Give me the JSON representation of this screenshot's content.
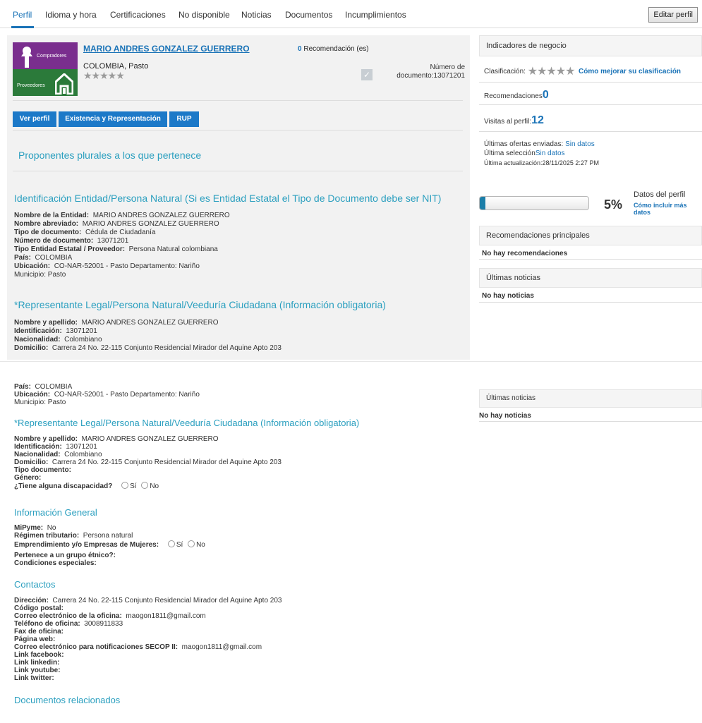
{
  "tabs": [
    "Perfil",
    "Idioma y hora",
    "Certificaciones",
    "No disponible",
    "Noticias",
    "Documentos",
    "Incumplimientos"
  ],
  "edit_button": "Editar perfil",
  "profile": {
    "logo_top_label": "Compradores",
    "logo_bottom_label": "Proveedores",
    "name": "MARIO ANDRES GONZALEZ GUERRERO",
    "location": "COLOMBIA, Pasto",
    "rec_count": "0",
    "rec_label": "Recomendación (es)",
    "doc_label": "Número de",
    "doc_value": "documento:13071201",
    "stars_filled": 0,
    "stars_total": 5
  },
  "buttons": [
    "Ver perfil",
    "Existencia y Representación",
    "RUP"
  ],
  "sections": {
    "plural": "Proponentes plurales a los que pertenece",
    "identification": "Identificación Entidad/Persona Natural (Si es Entidad Estatal el Tipo de Documento debe ser NIT)",
    "legal_rep": "*Representante Legal/Persona Natural/Veeduría Ciudadana (Información obligatoria)",
    "general": "Información General",
    "contacts": "Contactos",
    "documents": "Documentos relacionados"
  },
  "identification_fields": [
    {
      "label": "Nombre de la Entidad:",
      "value": "MARIO ANDRES GONZALEZ GUERRERO"
    },
    {
      "label": "Nombre abreviado:",
      "value": "MARIO ANDRES GONZALEZ GUERRERO"
    },
    {
      "label": "Tipo de documento:",
      "value": "Cédula de Ciudadanía"
    },
    {
      "label": "Número de documento:",
      "value": "13071201"
    },
    {
      "label": "Tipo Entidad Estatal / Proveedor:",
      "value": "Persona Natural colombiana"
    },
    {
      "label": "País:",
      "value": "COLOMBIA"
    },
    {
      "label": "Ubicación:",
      "value": "CO-NAR-52001 - Pasto Departamento: Nariño"
    },
    {
      "label": "",
      "value": "Municipio: Pasto"
    }
  ],
  "legal_rep_fields": [
    {
      "label": "Nombre y apellido:",
      "value": "MARIO ANDRES GONZALEZ GUERRERO"
    },
    {
      "label": "Identificación:",
      "value": "13071201"
    },
    {
      "label": "Nacionalidad:",
      "value": "Colombiano"
    },
    {
      "label": "Domicilio:",
      "value": "Carrera 24 No. 22-115 Conjunto Residencial Mirador del Aquine Apto 203"
    },
    {
      "label": "Tipo documento:",
      "value": ""
    },
    {
      "label": "Género:",
      "value": ""
    }
  ],
  "disability": {
    "label": "¿Tiene alguna discapacidad?",
    "yes": "Sí",
    "no": "No"
  },
  "general_fields": [
    {
      "label": "MiPyme:",
      "value": "No"
    },
    {
      "label": "Régimen tributario:",
      "value": "Persona natural"
    }
  ],
  "women_business": {
    "label": "Emprendimiento y/o Empresas de Mujeres:",
    "yes": "Sí",
    "no": "No"
  },
  "general_fields_2": [
    {
      "label": "Pertenece a un grupo étnico?:",
      "value": ""
    },
    {
      "label": "Condiciones especiales:",
      "value": ""
    }
  ],
  "contact_fields": [
    {
      "label": "Dirección:",
      "value": "Carrera 24 No. 22-115 Conjunto Residencial Mirador del Aquine Apto 203"
    },
    {
      "label": "Código postal:",
      "value": ""
    },
    {
      "label": "Correo electrónico de la oficina:",
      "value": "maogon1811@gmail.com"
    },
    {
      "label": "Teléfono de oficina:",
      "value": "3008911833"
    },
    {
      "label": "Fax de oficina:",
      "value": ""
    },
    {
      "label": "Página web:",
      "value": ""
    },
    {
      "label": "Correo electrónico para notificaciones SECOP II:",
      "value": "maogon1811@gmail.com"
    },
    {
      "label": "Link facebook:",
      "value": ""
    },
    {
      "label": "Link linkedin:",
      "value": ""
    },
    {
      "label": "Link youtube:",
      "value": ""
    },
    {
      "label": "Link twitter:",
      "value": ""
    }
  ],
  "right": {
    "indicators_title": "Indicadores de negocio",
    "classification_label": "Clasificación:",
    "improve_link": "Cómo mejorar su clasificación",
    "recommendations_label": "Recomendaciones",
    "recommendations_value": "0",
    "visits_label": "Visitas al perfil:",
    "visits_value": "12",
    "offers_label": "Últimas ofertas enviadas:",
    "offers_value": "Sin datos",
    "selection_label": "Última selección",
    "selection_value": "Sin datos",
    "update_label": "Última actualización:",
    "update_value": "28/11/2025 2:27 PM",
    "progress_percent": 5,
    "progress_text": "5%",
    "profile_data_label": "Datos del perfil",
    "include_more_1": "Cómo incluir más",
    "include_more_2": "datos",
    "top_recs_title": "Recomendaciones principales",
    "no_recs": "No hay recomendaciones",
    "news_title": "Últimas noticias",
    "no_news": "No hay noticias"
  }
}
